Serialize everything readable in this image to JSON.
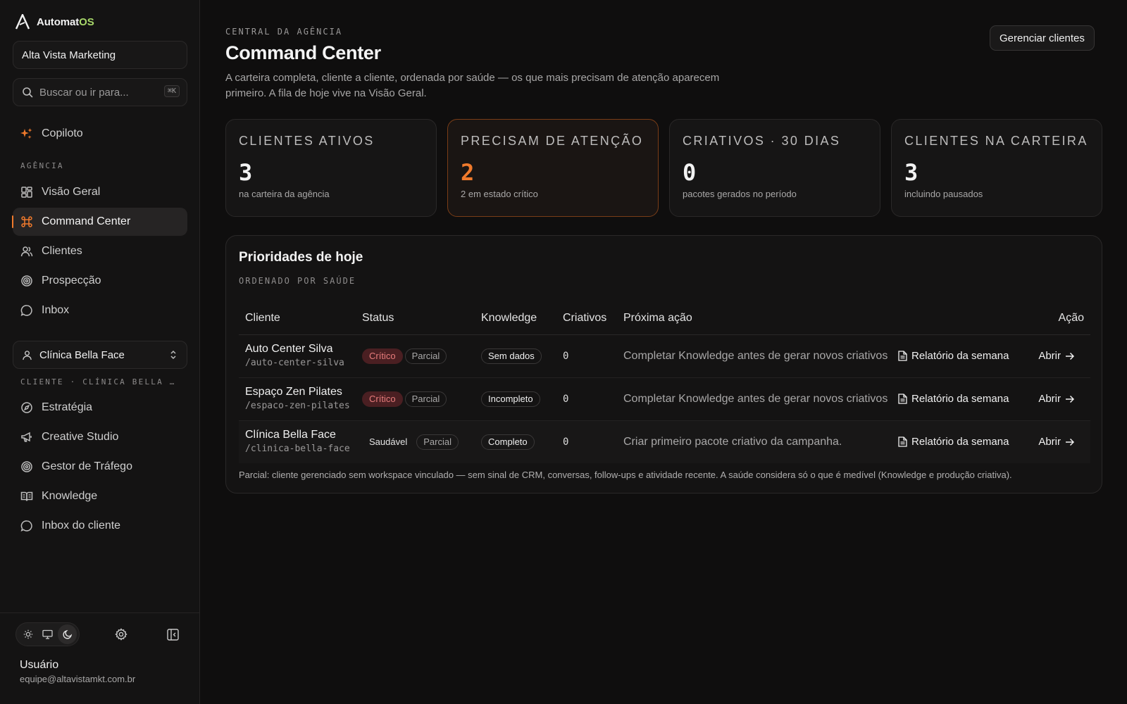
{
  "brand": {
    "name": "Automat",
    "suffix": "OS"
  },
  "sidebar": {
    "agency_name": "Alta Vista Marketing",
    "search_placeholder": "Buscar ou ir para...",
    "search_shortcut": "⌘K",
    "copilot_label": "Copiloto",
    "agency_section": "AGÊNCIA",
    "agency_items": [
      {
        "label": "Visão Geral",
        "icon": "dashboard-icon"
      },
      {
        "label": "Command Center",
        "icon": "command-icon",
        "active": true
      },
      {
        "label": "Clientes",
        "icon": "users-icon"
      },
      {
        "label": "Prospecção",
        "icon": "target-icon"
      },
      {
        "label": "Inbox",
        "icon": "chat-icon"
      }
    ],
    "selected_client": "Clínica Bella Face",
    "client_section": "CLIENTE · CLÍNICA BELLA …",
    "client_items": [
      {
        "label": "Estratégia",
        "icon": "compass-icon"
      },
      {
        "label": "Creative Studio",
        "icon": "megaphone-icon"
      },
      {
        "label": "Gestor de Tráfego",
        "icon": "target-icon"
      },
      {
        "label": "Knowledge",
        "icon": "book-icon"
      },
      {
        "label": "Inbox do cliente",
        "icon": "chat-icon"
      }
    ],
    "theme_options": [
      "light",
      "system",
      "dark"
    ],
    "theme_active": "dark",
    "user": {
      "name": "Usuário",
      "email": "equipe@altavistamkt.com.br"
    }
  },
  "header": {
    "eyebrow": "CENTRAL DA AGÊNCIA",
    "title": "Command Center",
    "description": "A carteira completa, cliente a cliente, ordenada por saúde — os que mais precisam de atenção aparecem primeiro. A fila de hoje vive na Visão Geral.",
    "manage_button": "Gerenciar clientes"
  },
  "stats": [
    {
      "label": "CLIENTES ATIVOS",
      "value": "3",
      "sub": "na carteira da agência"
    },
    {
      "label": "PRECISAM DE ATENÇÃO",
      "value": "2",
      "sub": "2 em estado crítico",
      "highlight": true
    },
    {
      "label": "CRIATIVOS · 30 DIAS",
      "value": "0",
      "sub": "pacotes gerados no período"
    },
    {
      "label": "CLIENTES NA CARTEIRA",
      "value": "3",
      "sub": "incluindo pausados"
    }
  ],
  "priorities": {
    "title": "Prioridades de hoje",
    "subtitle": "ORDENADO POR SAÚDE",
    "columns": [
      "Cliente",
      "Status",
      "Knowledge",
      "Criativos",
      "Próxima ação",
      "Ação"
    ],
    "rows": [
      {
        "name": "Auto Center Silva",
        "slug": "/auto-center-silva",
        "status": "Crítico",
        "status_kind": "crit",
        "scope": "Parcial",
        "knowledge": "Sem dados",
        "creatives": "0",
        "next_action": "Completar Knowledge antes de gerar novos criativos",
        "report": "Relatório da semana",
        "open": "Abrir"
      },
      {
        "name": "Espaço Zen Pilates",
        "slug": "/espaco-zen-pilates",
        "status": "Crítico",
        "status_kind": "crit",
        "scope": "Parcial",
        "knowledge": "Incompleto",
        "creatives": "0",
        "next_action": "Completar Knowledge antes de gerar novos criativos",
        "report": "Relatório da semana",
        "open": "Abrir"
      },
      {
        "name": "Clínica Bella Face",
        "slug": "/clinica-bella-face",
        "status": "Saudável",
        "status_kind": "ok",
        "scope": "Parcial",
        "knowledge": "Completo",
        "creatives": "0",
        "next_action": "Criar primeiro pacote criativo da campanha.",
        "report": "Relatório da semana",
        "open": "Abrir"
      }
    ],
    "note": "Parcial: cliente gerenciado sem workspace vinculado — sem sinal de CRM, conversas, follow-ups e atividade recente. A saúde considera só o que é medível (Knowledge e produção criativa)."
  },
  "colors": {
    "accent": "#f07a2c",
    "critical": "#e87c7c",
    "brand_os": "#a8d86a"
  }
}
